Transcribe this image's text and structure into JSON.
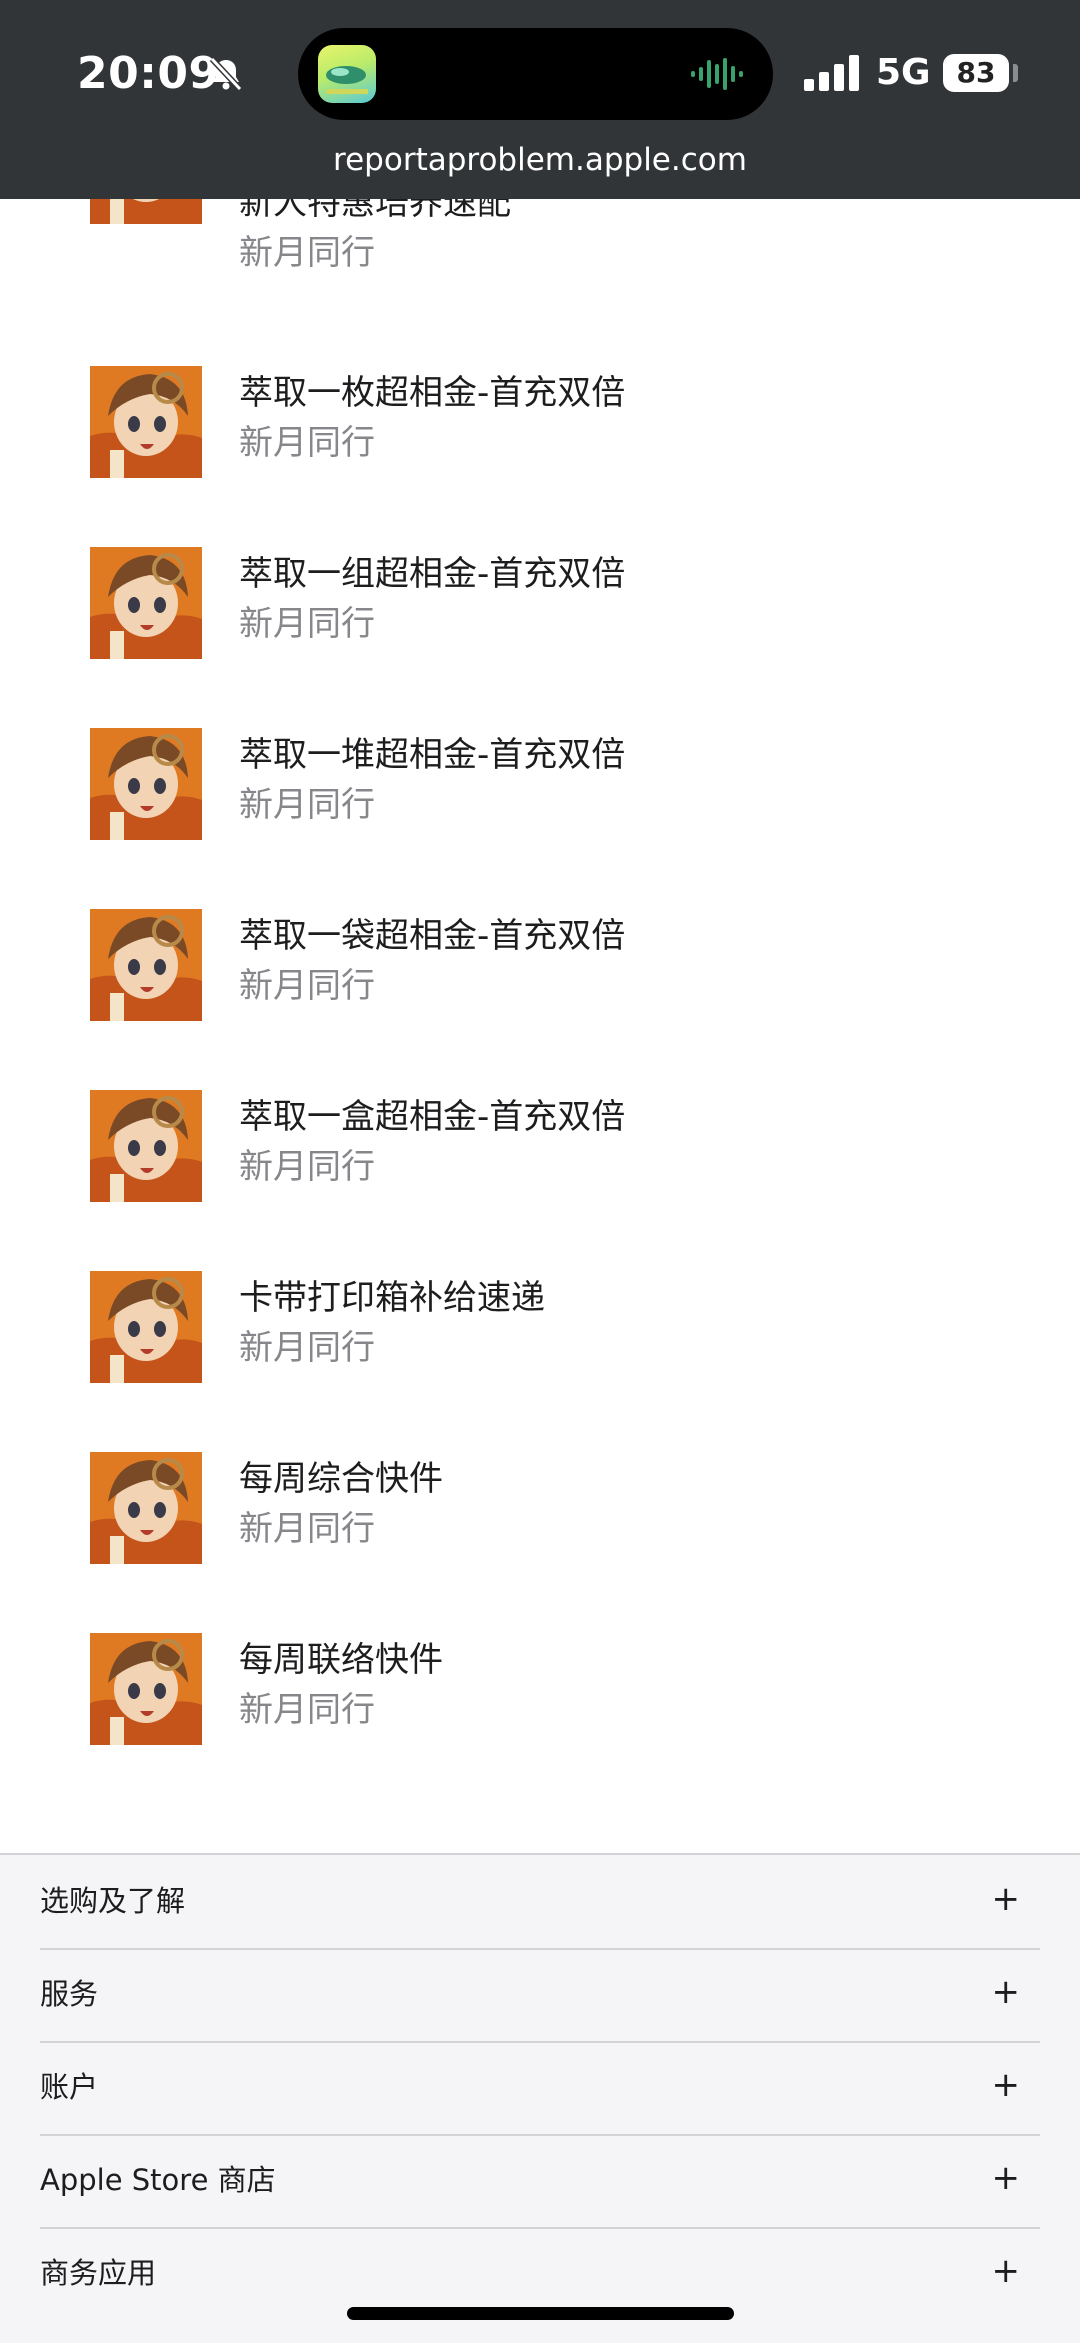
{
  "status_bar": {
    "time": "20:09",
    "network": "5G",
    "battery": "83",
    "icons": [
      "bell-slash-icon",
      "app-icon",
      "audio-waveform-icon",
      "cellular-signal-icon",
      "battery-icon"
    ]
  },
  "browser": {
    "url": "reportaproblem.apple.com"
  },
  "purchases": [
    {
      "title": "新人特惠培养速配",
      "subtitle": "新月同行"
    },
    {
      "title": "萃取一枚超相金-首充双倍",
      "subtitle": "新月同行"
    },
    {
      "title": "萃取一组超相金-首充双倍",
      "subtitle": "新月同行"
    },
    {
      "title": "萃取一堆超相金-首充双倍",
      "subtitle": "新月同行"
    },
    {
      "title": "萃取一袋超相金-首充双倍",
      "subtitle": "新月同行"
    },
    {
      "title": "萃取一盒超相金-首充双倍",
      "subtitle": "新月同行"
    },
    {
      "title": "卡带打印箱补给速递",
      "subtitle": "新月同行"
    },
    {
      "title": "每周综合快件",
      "subtitle": "新月同行"
    },
    {
      "title": "每周联络快件",
      "subtitle": "新月同行"
    }
  ],
  "footer": {
    "sections": [
      {
        "label": "选购及了解",
        "toggle": "+"
      },
      {
        "label": "服务",
        "toggle": "+"
      },
      {
        "label": "账户",
        "toggle": "+"
      },
      {
        "label": "Apple Store 商店",
        "toggle": "+"
      },
      {
        "label": "商务应用",
        "toggle": "+"
      }
    ]
  },
  "colors": {
    "top_bar": "#323538",
    "title_text": "#1d1d1f",
    "subtitle_text": "#86868b",
    "footer_bg": "#f5f5f7",
    "divider": "#d2d2d7"
  }
}
